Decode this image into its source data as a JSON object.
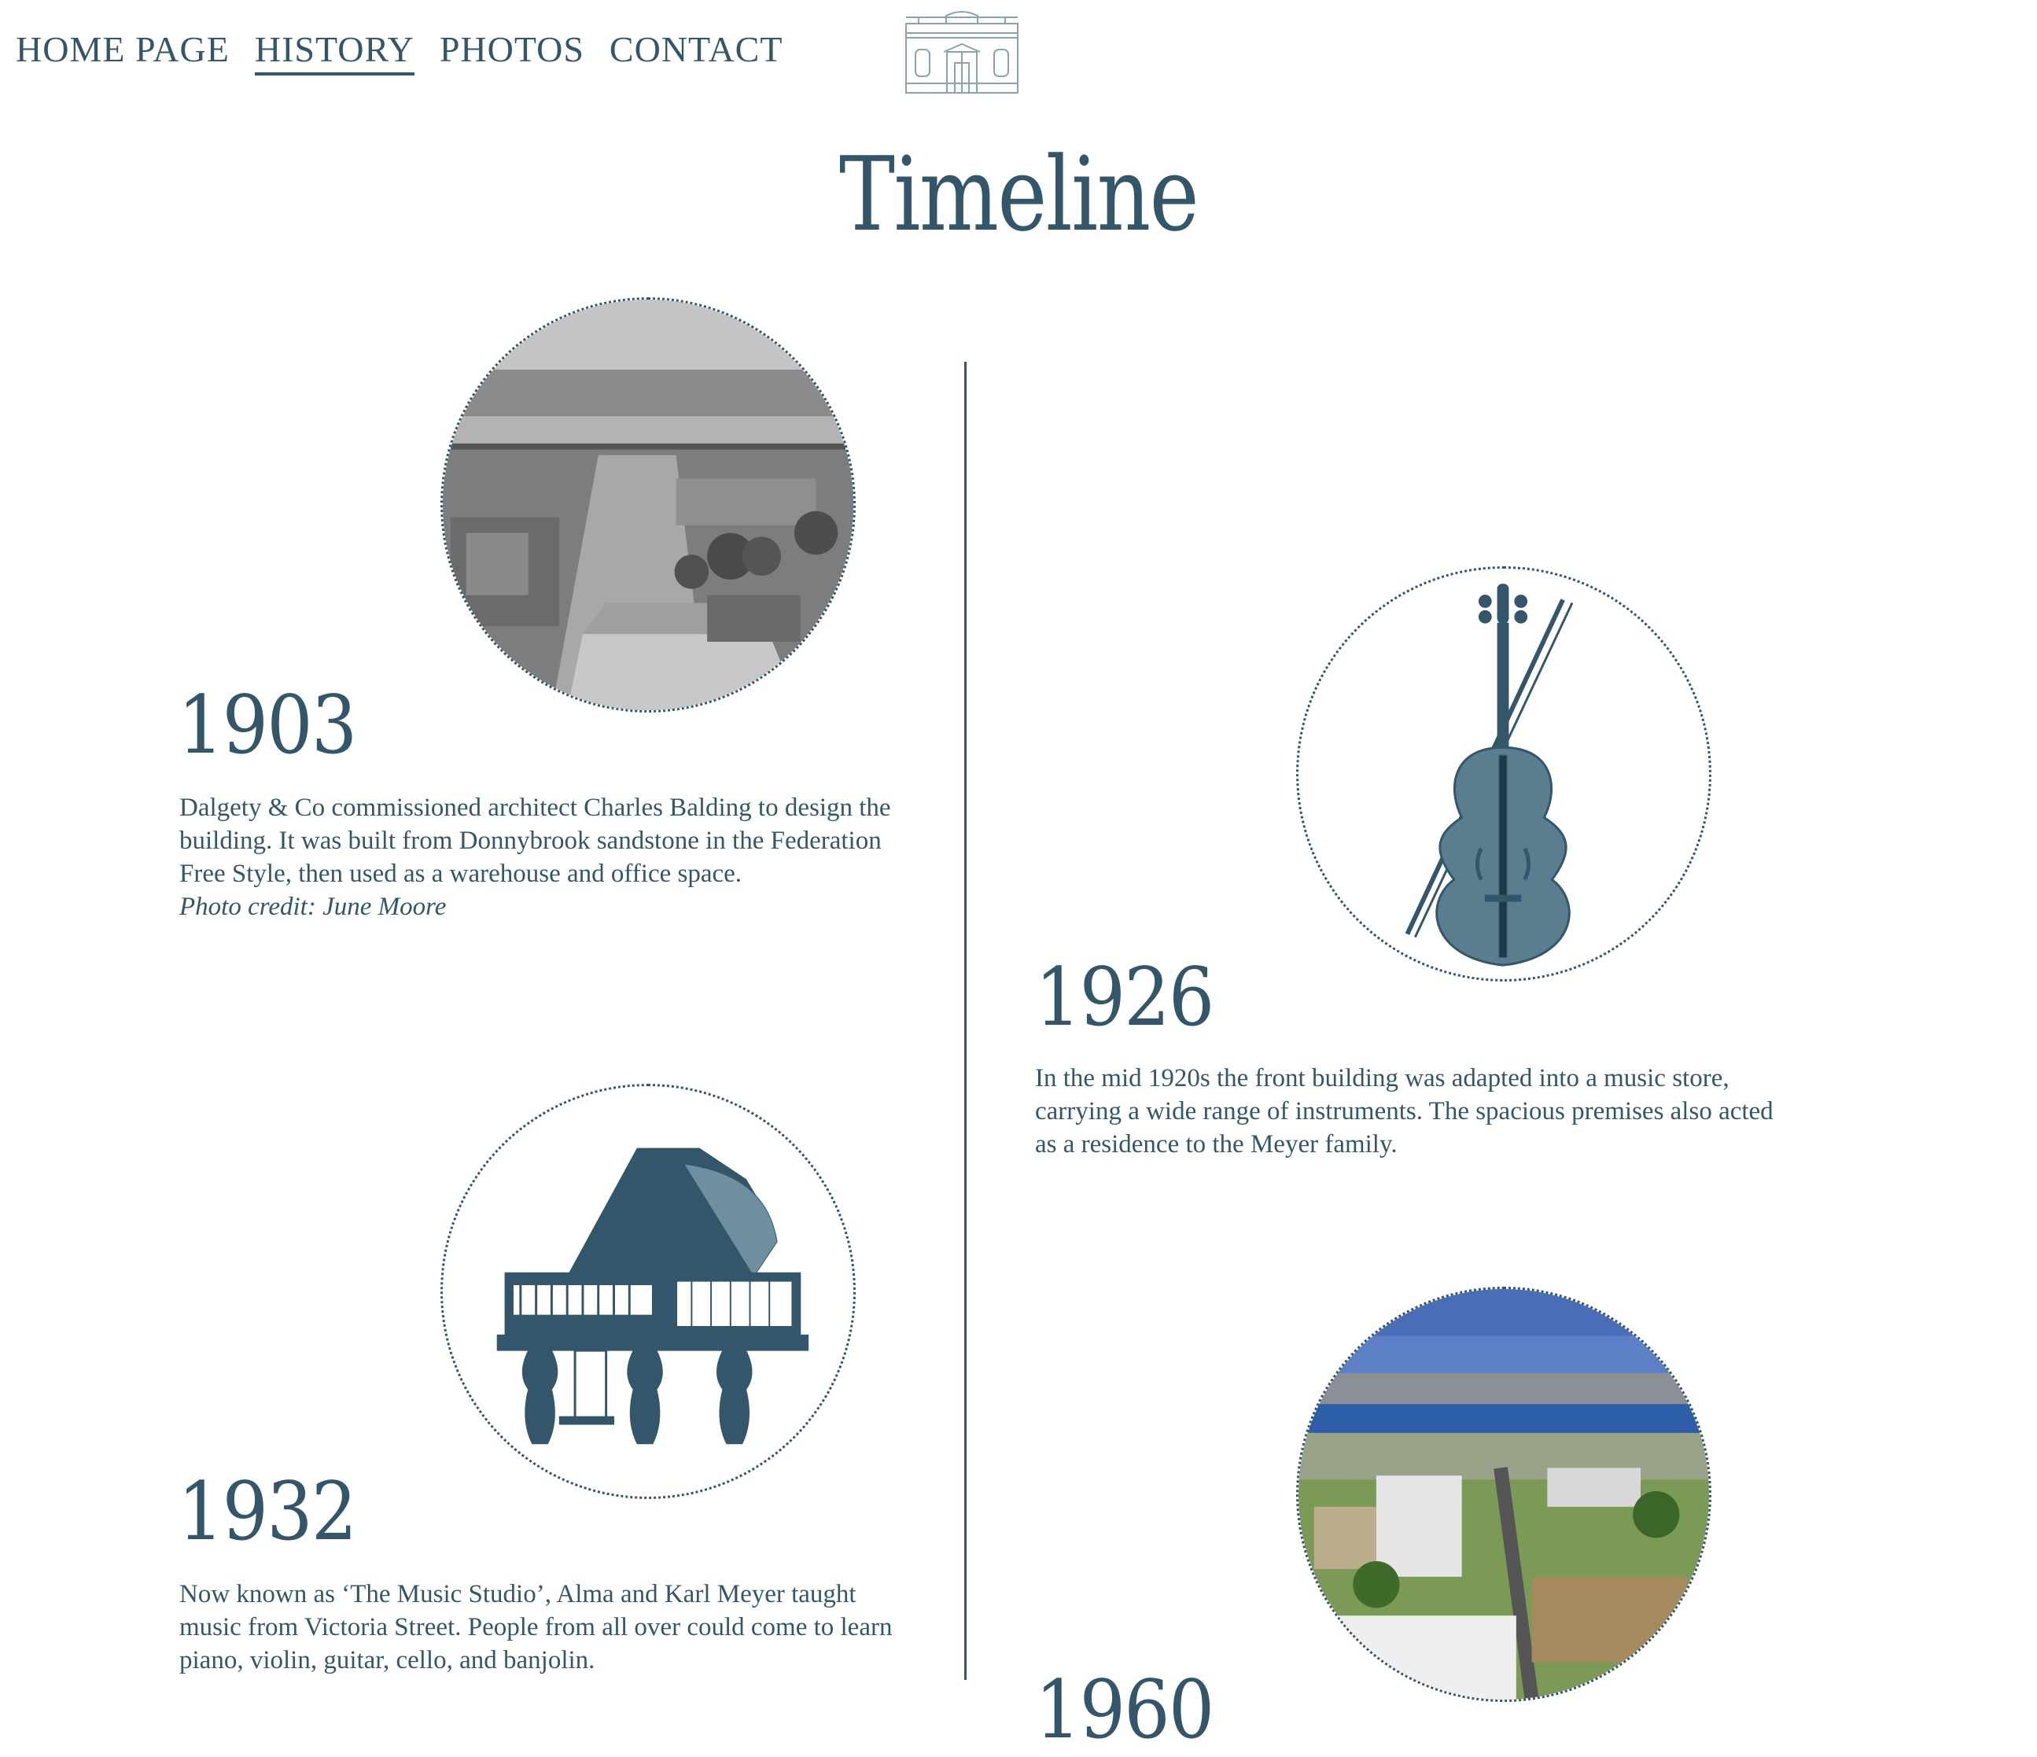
{
  "nav": {
    "items": [
      {
        "label": "HOME PAGE",
        "active": false
      },
      {
        "label": "HISTORY",
        "active": true
      },
      {
        "label": "PHOTOS",
        "active": false
      },
      {
        "label": "CONTACT",
        "active": false
      }
    ]
  },
  "page": {
    "title": "Timeline"
  },
  "entries": [
    {
      "year": "1903",
      "description": "Dalgety & Co commissioned architect Charles Balding to design the building. It was built from Donnybrook sandstone in the Federation Free Style, then used as a warehouse and office space.",
      "credit": "Photo credit: June Moore",
      "image": "historic-town-photo"
    },
    {
      "year": "1926",
      "description": "In the mid 1920s the front building was adapted into a music store, carrying a wide range of instruments. The spacious premises also acted as a residence to the Meyer family.",
      "image": "violin-illustration"
    },
    {
      "year": "1932",
      "description": "Now known as ‘The Music Studio’, Alma and Karl Meyer taught music from Victoria Street. People from all over could come to learn piano, violin, guitar, cello, and banjolin.",
      "image": "grand-piano-illustration"
    },
    {
      "year": "1960",
      "image": "aerial-town-photo"
    }
  ],
  "colors": {
    "primary": "#34566a",
    "background": "#ffffff"
  }
}
